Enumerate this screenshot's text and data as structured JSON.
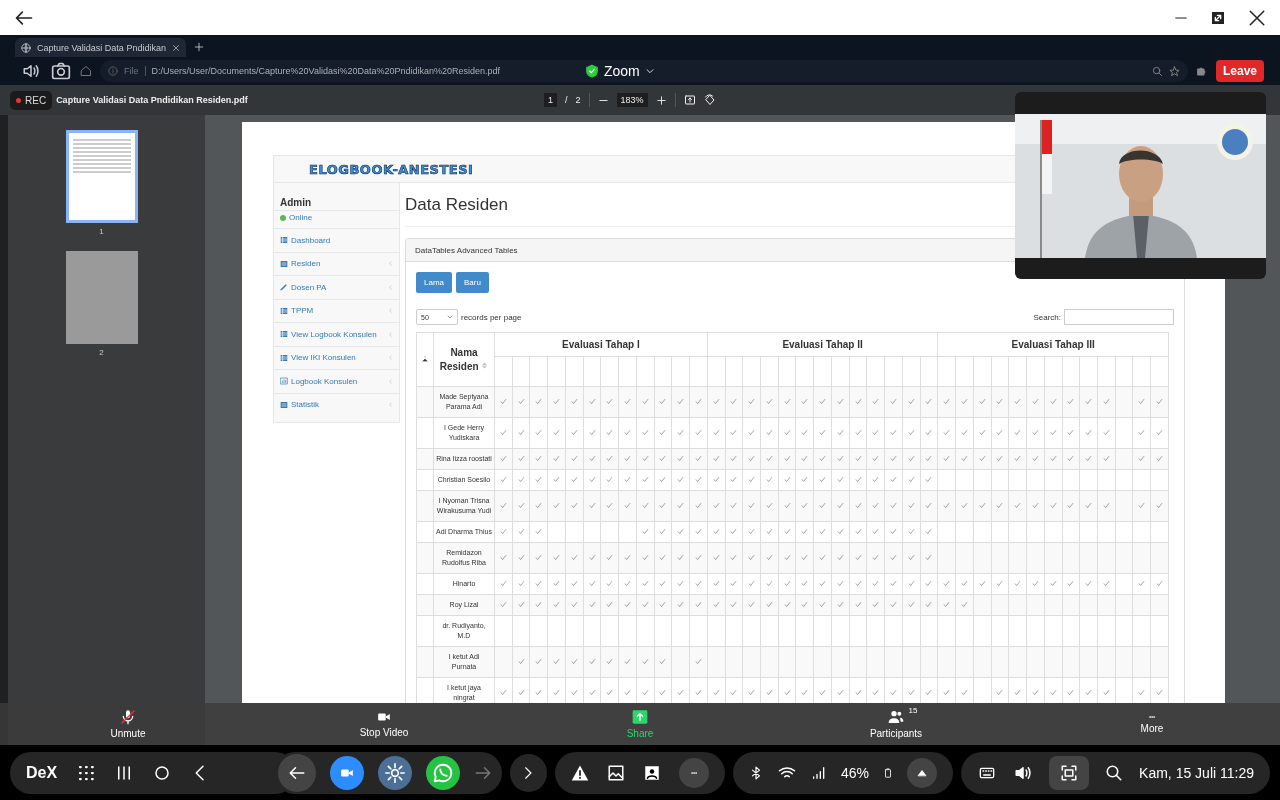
{
  "browser": {
    "tab": "Capture Validasi Data Pndidikan",
    "url_scheme": "File",
    "url": "D:/Users/User/Documents/Capture%20Validasi%20Data%20Pndidikan%20Residen.pdf",
    "site_name": "Zoom",
    "leave_button": "Leave"
  },
  "pdf_viewer": {
    "recording": "REC",
    "title": "Capture Validasi Data Pndidikan Residen.pdf",
    "page": "1",
    "page_separator": "/",
    "page_count": "2",
    "zoom": "183%",
    "thumbnails": [
      {
        "label": "1",
        "selected": true
      },
      {
        "label": "2",
        "selected": false
      }
    ]
  },
  "document": {
    "logo": "ELOGBOOK-ANESTESI",
    "user": "Admin",
    "status": "Online",
    "sidebar": {
      "items": [
        {
          "label": "Dashboard",
          "kind": "table",
          "submenu": false
        },
        {
          "label": "Residen",
          "kind": "list",
          "submenu": true
        },
        {
          "label": "Dosen PA",
          "kind": "pen",
          "submenu": true
        },
        {
          "label": "TPPM",
          "kind": "table",
          "submenu": true
        },
        {
          "label": "View Logbook Konsulen",
          "kind": "table",
          "submenu": true
        },
        {
          "label": "View IKI Konsulen",
          "kind": "table",
          "submenu": true
        },
        {
          "label": "Logbook Konsulen",
          "kind": "chart",
          "submenu": true
        },
        {
          "label": "Statistik",
          "kind": "list",
          "submenu": true
        }
      ]
    },
    "heading": "Data Residen",
    "panel_title": "DataTables Advanced Tables",
    "buttons": [
      "Lama",
      "Baru"
    ],
    "page_size": "50",
    "page_size_label": "records per page",
    "search_label": "Search:",
    "table": {
      "name_column": "Nama Residen",
      "groups": [
        "Evaluasi Tahap I",
        "Evaluasi Tahap II",
        "Evaluasi Tahap III"
      ],
      "rows": [
        {
          "name": "Made Septyana Parama Adi",
          "checks": [
            [
              true,
              true,
              true,
              true,
              true,
              true,
              true,
              true,
              true,
              true,
              true,
              true
            ],
            [
              true,
              true,
              true,
              true,
              true,
              true,
              true,
              true,
              true,
              true,
              true,
              true,
              true
            ],
            [
              true,
              true,
              true,
              true,
              true,
              true,
              true,
              true,
              true,
              true,
              false,
              true,
              true
            ]
          ]
        },
        {
          "name": "I Gede Herry Yudiskara",
          "checks": [
            [
              true,
              true,
              true,
              true,
              true,
              true,
              true,
              true,
              true,
              true,
              true,
              true
            ],
            [
              true,
              true,
              true,
              true,
              true,
              true,
              true,
              true,
              true,
              true,
              true,
              true,
              true
            ],
            [
              true,
              true,
              true,
              true,
              true,
              true,
              true,
              true,
              true,
              true,
              false,
              true,
              true
            ]
          ]
        },
        {
          "name": "Rina Iizza roostati",
          "checks": [
            [
              true,
              true,
              true,
              true,
              true,
              true,
              true,
              true,
              true,
              true,
              true,
              true
            ],
            [
              true,
              true,
              true,
              true,
              true,
              true,
              true,
              true,
              true,
              true,
              true,
              true,
              true
            ],
            [
              true,
              true,
              true,
              true,
              true,
              true,
              true,
              true,
              true,
              true,
              false,
              true,
              true
            ]
          ]
        },
        {
          "name": "Christian Soesilo",
          "checks": [
            [
              true,
              true,
              true,
              true,
              true,
              true,
              true,
              true,
              true,
              true,
              true,
              true
            ],
            [
              true,
              true,
              true,
              true,
              true,
              true,
              true,
              true,
              true,
              true,
              true,
              true,
              true
            ],
            [
              false,
              false,
              false,
              false,
              false,
              false,
              false,
              false,
              false,
              false,
              false,
              false,
              false
            ]
          ]
        },
        {
          "name": "I Nyoman Trisna Wirakusuma Yudi",
          "checks": [
            [
              true,
              true,
              true,
              true,
              true,
              true,
              true,
              true,
              true,
              true,
              true,
              true
            ],
            [
              true,
              true,
              true,
              true,
              true,
              true,
              true,
              true,
              true,
              true,
              true,
              true,
              true
            ],
            [
              true,
              true,
              true,
              true,
              true,
              true,
              true,
              true,
              true,
              true,
              false,
              true,
              true
            ]
          ]
        },
        {
          "name": "Adi Dharma Thius",
          "checks": [
            [
              true,
              true,
              true,
              false,
              false,
              false,
              false,
              false,
              true,
              true,
              true,
              true
            ],
            [
              true,
              true,
              true,
              true,
              true,
              true,
              true,
              true,
              true,
              true,
              true,
              true,
              true
            ],
            [
              false,
              false,
              false,
              false,
              false,
              false,
              false,
              false,
              false,
              false,
              false,
              false,
              false
            ]
          ]
        },
        {
          "name": "Remidazon Rudolfus Riba",
          "checks": [
            [
              true,
              true,
              true,
              true,
              true,
              true,
              true,
              true,
              true,
              true,
              true,
              true
            ],
            [
              true,
              true,
              true,
              true,
              true,
              true,
              true,
              true,
              true,
              true,
              true,
              true,
              true
            ],
            [
              false,
              false,
              false,
              false,
              false,
              false,
              false,
              false,
              false,
              false,
              false,
              false,
              false
            ]
          ]
        },
        {
          "name": "Hinarto",
          "checks": [
            [
              true,
              true,
              true,
              true,
              true,
              true,
              true,
              true,
              true,
              true,
              true,
              true
            ],
            [
              true,
              true,
              true,
              true,
              true,
              true,
              true,
              true,
              true,
              true,
              true,
              true,
              true
            ],
            [
              true,
              true,
              true,
              true,
              true,
              true,
              true,
              true,
              true,
              true,
              false,
              true,
              true
            ]
          ]
        },
        {
          "name": "Roy Lizal",
          "checks": [
            [
              true,
              true,
              true,
              true,
              true,
              true,
              true,
              true,
              true,
              true,
              true,
              true
            ],
            [
              true,
              true,
              true,
              true,
              true,
              true,
              true,
              true,
              true,
              true,
              true,
              true,
              true
            ],
            [
              true,
              true,
              false,
              false,
              false,
              false,
              false,
              false,
              false,
              false,
              false,
              false,
              false
            ]
          ]
        },
        {
          "name": "dr. Rudiyanto, M.D",
          "checks": [
            [
              false,
              false,
              false,
              false,
              false,
              false,
              false,
              false,
              false,
              false,
              false,
              false
            ],
            [
              false,
              false,
              false,
              false,
              false,
              false,
              false,
              false,
              false,
              false,
              false,
              false,
              false
            ],
            [
              false,
              false,
              false,
              false,
              false,
              false,
              false,
              false,
              false,
              false,
              false,
              false,
              false
            ]
          ]
        },
        {
          "name": "I ketut Adi Purnata",
          "checks": [
            [
              false,
              true,
              true,
              true,
              true,
              true,
              true,
              true,
              true,
              true,
              false,
              true
            ],
            [
              false,
              false,
              false,
              false,
              false,
              false,
              false,
              false,
              false,
              false,
              false,
              false,
              false
            ],
            [
              false,
              false,
              false,
              false,
              false,
              false,
              false,
              false,
              false,
              false,
              false,
              false,
              false
            ]
          ]
        },
        {
          "name": "I ketut jaya ningrat",
          "checks": [
            [
              true,
              true,
              true,
              true,
              true,
              true,
              true,
              true,
              true,
              true,
              true,
              true
            ],
            [
              true,
              true,
              true,
              true,
              true,
              true,
              true,
              true,
              true,
              true,
              true,
              true,
              true
            ],
            [
              true,
              true,
              false,
              true,
              true,
              true,
              true,
              true,
              true,
              true,
              false,
              true,
              true
            ]
          ]
        }
      ]
    }
  },
  "meeting_bar": {
    "items": [
      {
        "label": "Unmute",
        "kind": "mic-off"
      },
      {
        "label": "Stop Video",
        "kind": "camera"
      },
      {
        "label": "Share",
        "kind": "share"
      },
      {
        "label": "Participants",
        "kind": "people",
        "count": "15"
      },
      {
        "label": "More",
        "kind": "more"
      }
    ]
  },
  "taskbar": {
    "dex": "DeX",
    "battery": "46%",
    "clock": "Kam, 15 Juli 11:29"
  }
}
